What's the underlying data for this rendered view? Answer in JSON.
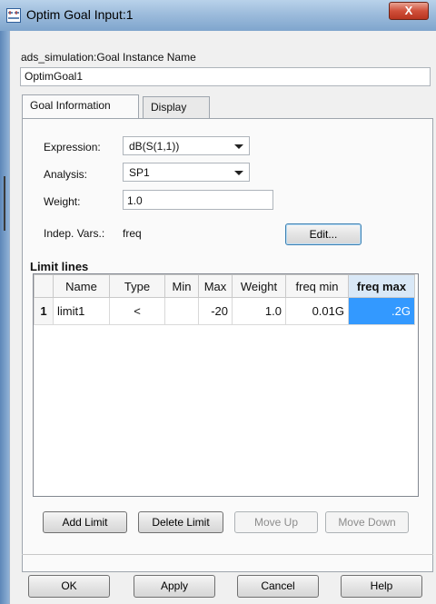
{
  "window": {
    "title": "Optim Goal Input:1",
    "close_label": "X"
  },
  "instance": {
    "label": "ads_simulation:Goal Instance Name",
    "value": "OptimGoal1"
  },
  "tabs": [
    {
      "label": "Goal Information",
      "active": true
    },
    {
      "label": "Display",
      "active": false
    }
  ],
  "goal": {
    "expression_label": "Expression:",
    "expression_value": "dB(S(1,1))",
    "analysis_label": "Analysis:",
    "analysis_value": "SP1",
    "weight_label": "Weight:",
    "weight_value": "1.0",
    "indep_vars_label": "Indep. Vars.:",
    "indep_vars_value": "freq",
    "edit_button": "Edit..."
  },
  "limit_lines": {
    "title": "Limit lines",
    "columns": [
      "",
      "Name",
      "Type",
      "Min",
      "Max",
      "Weight",
      "freq min",
      "freq max"
    ],
    "rows": [
      {
        "index": "1",
        "name": "limit1",
        "type": "<",
        "min": "",
        "max": "-20",
        "weight": "1.0",
        "freq_min": "0.01G",
        "freq_max": ".2G"
      }
    ],
    "selected_column": "freq max",
    "buttons": {
      "add": "Add Limit",
      "delete": "Delete Limit",
      "move_up": "Move Up",
      "move_down": "Move Down"
    }
  },
  "footer": {
    "ok": "OK",
    "apply": "Apply",
    "cancel": "Cancel",
    "help": "Help"
  },
  "colors": {
    "selection": "#3399ff",
    "title_gradient": "#9dbcdc",
    "close_button": "#d0503a"
  }
}
